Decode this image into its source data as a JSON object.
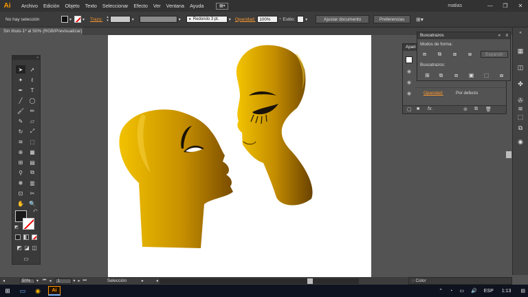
{
  "app": {
    "logo": "Ai",
    "user": "matias"
  },
  "menu": [
    "Archivo",
    "Edición",
    "Objeto",
    "Texto",
    "Seleccionar",
    "Efecto",
    "Ver",
    "Ventana",
    "Ayuda"
  ],
  "control": {
    "selection": "No hay selección",
    "stroke_label": "Trazo:",
    "brush": "Redondo 3 pt.",
    "opacity_label": "Opacidad:",
    "opacity_value": "100%",
    "style_label": "Estilo:",
    "fit_document": "Ajustar documento",
    "preferences": "Preferencias"
  },
  "document": {
    "tab": "Sin título-1* al 50% (RGB/Previsualizar)"
  },
  "pathfinder": {
    "title": "Buscatrazos",
    "shape_modes": "Modos de forma:",
    "expand": "Expandir",
    "pathfinders": "Buscatrazos:"
  },
  "appearance": {
    "title": "Apari",
    "opacity_label": "Opacidad:",
    "opacity_value": "Por defecto"
  },
  "status": {
    "zoom": "50%",
    "page": "1",
    "tool": "Selección"
  },
  "color_panel": {
    "title": "Color"
  },
  "taskbar": {
    "lang": "ESP",
    "time": "1:13"
  },
  "colors": {
    "gold_light": "#f2c200",
    "gold_dark": "#6e4500",
    "menubar": "#323232",
    "canvas": "#535353"
  }
}
